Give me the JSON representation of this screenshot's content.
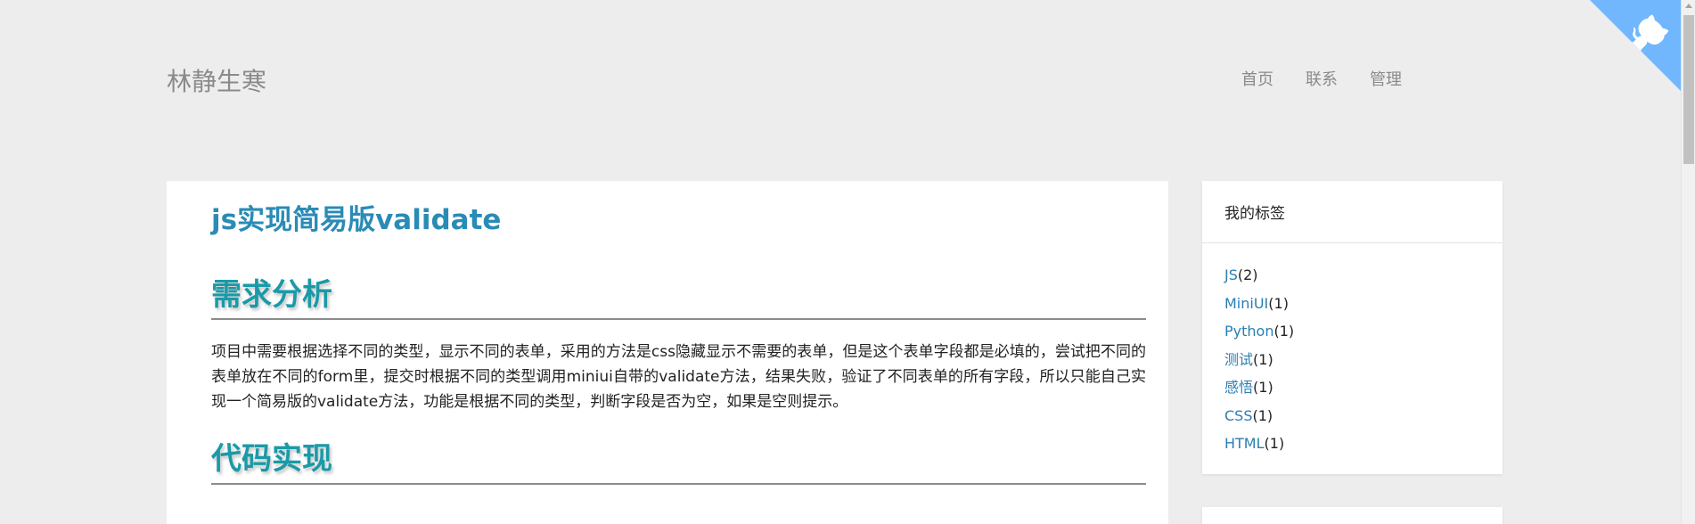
{
  "header": {
    "site_title": "林静生寒",
    "nav": [
      {
        "label": "首页"
      },
      {
        "label": "联系"
      },
      {
        "label": "管理"
      }
    ]
  },
  "article": {
    "title": "js实现简易版validate",
    "sections": [
      {
        "heading": "需求分析",
        "paragraph": "项目中需要根据选择不同的类型，显示不同的表单，采用的方法是css隐藏显示不需要的表单，但是这个表单字段都是必填的，尝试把不同的表单放在不同的form里，提交时根据不同的类型调用miniui自带的validate方法，结果失败，验证了不同表单的所有字段，所以只能自己实现一个简易版的validate方法，功能是根据不同的类型，判断字段是否为空，如果是空则提示。"
      },
      {
        "heading": "代码实现"
      }
    ]
  },
  "sidebar": {
    "tags_title": "我的标签",
    "tags": [
      {
        "name": "JS",
        "count": "(2)"
      },
      {
        "name": "MiniUI",
        "count": "(1)"
      },
      {
        "name": "Python",
        "count": "(1)"
      },
      {
        "name": "测试",
        "count": "(1)"
      },
      {
        "name": "感悟",
        "count": "(1)"
      },
      {
        "name": "CSS",
        "count": "(1)"
      },
      {
        "name": "HTML",
        "count": "(1)"
      }
    ]
  },
  "colors": {
    "background": "#ededed",
    "title_blue": "#2a8bb6",
    "heading_teal": "#1a9aa8",
    "link_blue": "#2a7fb0",
    "github_corner": "#70b7fd"
  },
  "icons": {
    "github_corner": "github-octocat-icon"
  }
}
